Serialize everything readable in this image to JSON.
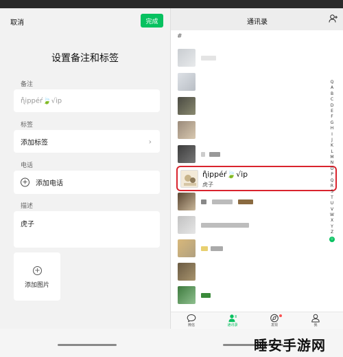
{
  "left": {
    "cancel_label": "取消",
    "done_label": "完成",
    "title": "设置备注和标签",
    "remark": {
      "label": "备注",
      "value": "ɳ̊ippéŕ🍃√ip"
    },
    "tags": {
      "label": "标签",
      "add_label": "添加标签"
    },
    "phone": {
      "label": "电话",
      "add_label": "添加电话"
    },
    "description": {
      "label": "描述",
      "value": "虎子"
    },
    "photo": {
      "add_label": "添加图片"
    }
  },
  "right": {
    "title": "通讯录",
    "section_letter": "#",
    "highlighted_contact": {
      "name": "ɳ̊ippéŕ🍃√ip",
      "remark": "虎子"
    },
    "alpha_index": [
      "Q",
      "A",
      "B",
      "C",
      "D",
      "E",
      "F",
      "G",
      "H",
      "I",
      "J",
      "K",
      "L",
      "M",
      "N",
      "O",
      "P",
      "Q",
      "R",
      "S",
      "T",
      "U",
      "V",
      "W",
      "X",
      "Y",
      "Z"
    ],
    "alpha_star": "☆",
    "tabs": [
      {
        "label": "微信",
        "icon": "chat-icon",
        "active": false
      },
      {
        "label": "通讯录",
        "icon": "contacts-icon",
        "active": true
      },
      {
        "label": "发现",
        "icon": "compass-icon",
        "active": false
      },
      {
        "label": "我",
        "icon": "person-icon",
        "active": false
      }
    ]
  },
  "watermark": "睡安手游网",
  "colors": {
    "accent": "#07c160",
    "highlight_border": "#d9232d",
    "badge": "#fa5151"
  }
}
